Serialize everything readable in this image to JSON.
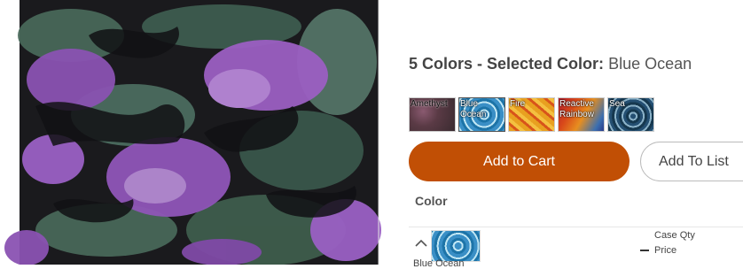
{
  "product": {
    "image_alt": "Purple and dark green tie-dye fabric",
    "color_count_label": "5 Colors - Selected Color:",
    "selected_color": "Blue Ocean"
  },
  "swatches": [
    {
      "label": "Amethyst",
      "selected": false
    },
    {
      "label": "Blue Ocean",
      "selected": true
    },
    {
      "label": "Fire",
      "selected": false
    },
    {
      "label": "Reactive Rainbow",
      "selected": false
    },
    {
      "label": "Sea",
      "selected": false
    }
  ],
  "actions": {
    "add_to_cart": "Add to Cart",
    "add_to_list": "Add To List"
  },
  "variant_table": {
    "column_header": "Color",
    "case_qty_label": "Case Qty",
    "price_label": "Price",
    "rows": [
      {
        "name": "Blue Ocean"
      }
    ]
  },
  "colors": {
    "cart_button": "#c14f05",
    "fabric_purple": "#9b5fc2",
    "fabric_green": "#4a6b5c"
  },
  "icons": {
    "row_toggle": "chevron-up-icon",
    "price_toggle": "minus-icon"
  }
}
